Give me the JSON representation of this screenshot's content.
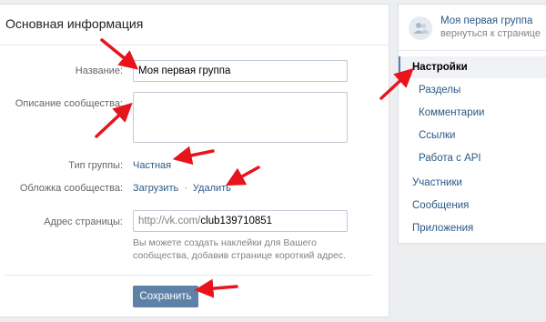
{
  "main": {
    "title": "Основная информация",
    "name_label": "Название:",
    "name_value": "Моя первая группа",
    "description_label": "Описание сообщества:",
    "description_value": "",
    "type_label": "Тип группы:",
    "type_value": "Частная",
    "cover_label": "Обложка сообщества:",
    "cover_upload": "Загрузить",
    "cover_separator": "·",
    "cover_delete": "Удалить",
    "address_label": "Адрес страницы:",
    "address_prefix": "http://vk.com/",
    "address_value": "club139710851",
    "address_hint": "Вы можете создать наклейки для Вашего сообщества, добавив странице короткий адрес.",
    "save_label": "Сохранить"
  },
  "sidebar": {
    "group_name": "Моя первая группа",
    "group_back": "вернуться к странице",
    "items": [
      {
        "label": "Настройки",
        "active": true
      },
      {
        "label": "Разделы"
      },
      {
        "label": "Комментарии"
      },
      {
        "label": "Ссылки"
      },
      {
        "label": "Работа с API"
      },
      {
        "label": "Участники"
      },
      {
        "label": "Сообщения"
      },
      {
        "label": "Приложения"
      }
    ]
  },
  "colors": {
    "accent": "#2a5885",
    "button": "#5e81a8",
    "arrow": "#e8141c",
    "background": "#edeef0"
  },
  "icons": {
    "avatar": "group-users-icon",
    "annotation": "red-arrow-icon"
  }
}
